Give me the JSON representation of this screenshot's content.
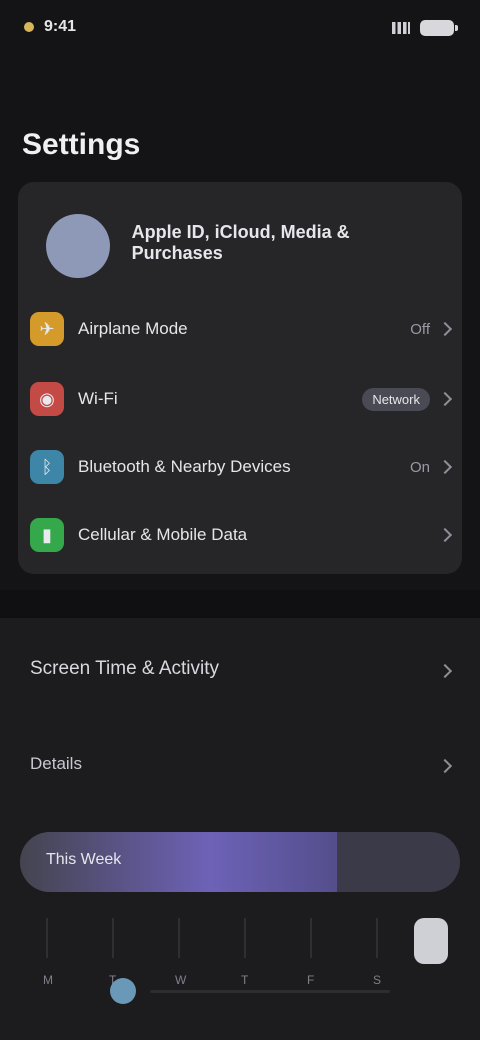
{
  "status": {
    "time": "9:41"
  },
  "title": "Settings",
  "account": {
    "name": "Apple ID, iCloud, Media & Purchases",
    "subtitle": ""
  },
  "rows": [
    {
      "label": "Airplane Mode",
      "right": "Off",
      "color": "#d49b2b",
      "icon": "airplane-icon"
    },
    {
      "label": "Wi-Fi",
      "right": "Network",
      "color": "#c44a46",
      "icon": "wifi-icon"
    },
    {
      "label": "Bluetooth & Nearby Devices",
      "right": "On",
      "color": "#3e86a7",
      "icon": "bluetooth-icon"
    },
    {
      "label": "Cellular & Mobile Data",
      "right": "",
      "color": "#35a84b",
      "icon": "cellular-icon"
    }
  ],
  "lower": {
    "section_title": "Screen Time & Activity",
    "sub_row": "Details",
    "pill_text": "This Week",
    "pill_fill_fraction": 0.72,
    "ticks": [
      "M",
      "T",
      "W",
      "T",
      "F",
      "S"
    ]
  }
}
